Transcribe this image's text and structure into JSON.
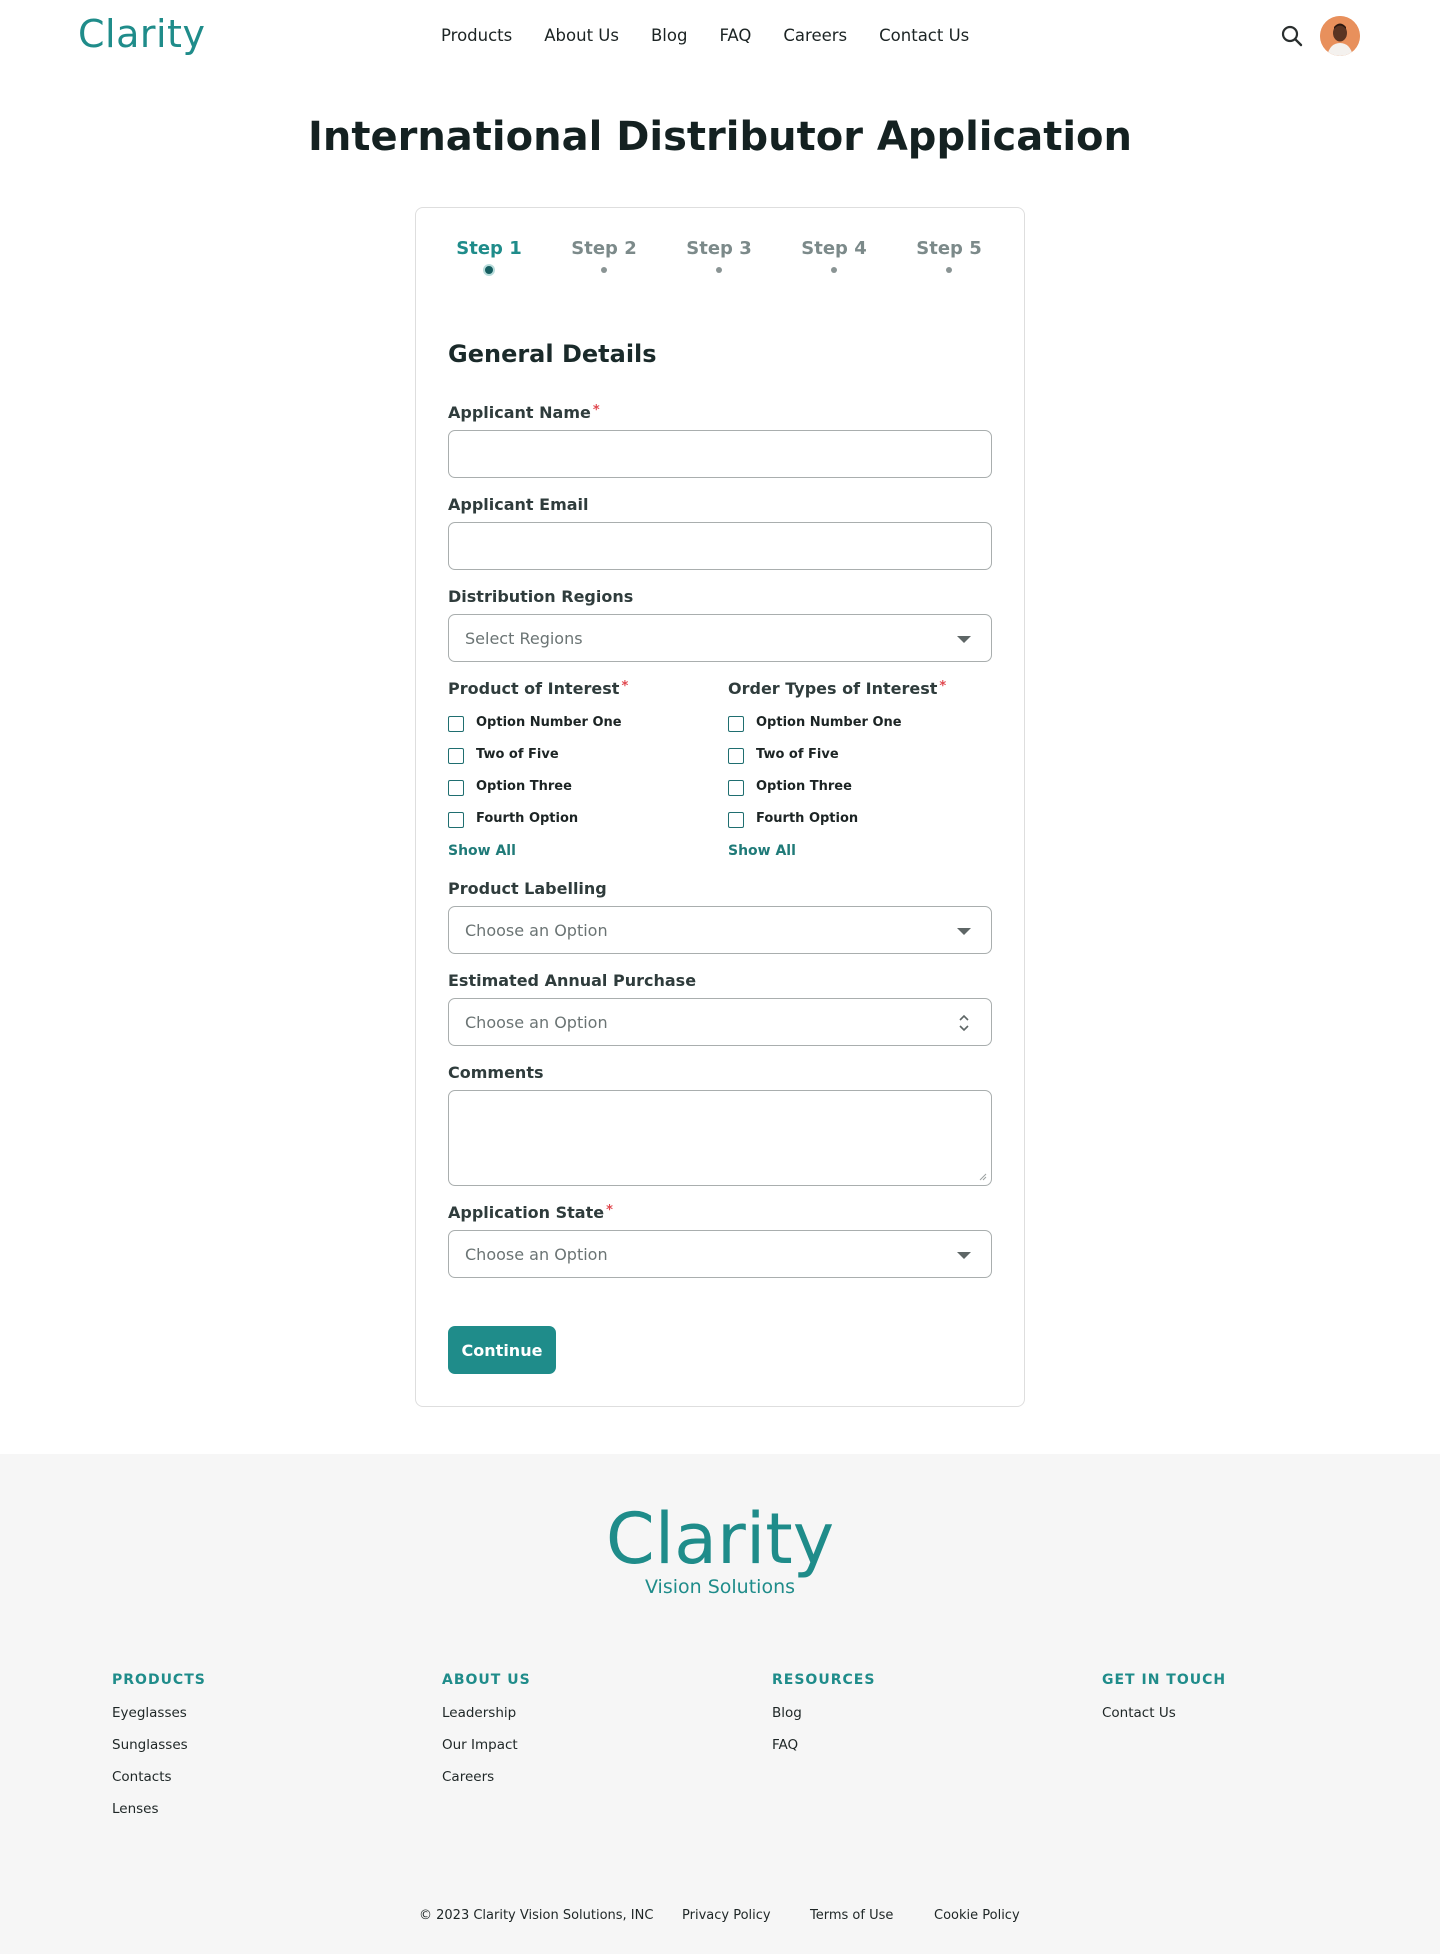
{
  "header": {
    "logo": "Clarity",
    "nav": [
      "Products",
      "About Us",
      "Blog",
      "FAQ",
      "Careers",
      "Contact Us"
    ]
  },
  "page": {
    "title": "International Distributor Application"
  },
  "stepper": {
    "steps": [
      "Step 1",
      "Step 2",
      "Step 3",
      "Step 4",
      "Step 5"
    ],
    "active_step": "Step 1"
  },
  "form": {
    "section_title": "General Details",
    "applicant_name": {
      "label": "Applicant Name",
      "required": "*",
      "value": ""
    },
    "applicant_email": {
      "label": "Applicant Email",
      "value": ""
    },
    "distribution_regions": {
      "label": "Distribution Regions",
      "placeholder": "Select Regions"
    },
    "product_of_interest": {
      "label": "Product of Interest",
      "required": "*",
      "options": [
        "Option Number One",
        "Two of Five",
        "Option Three",
        "Fourth Option"
      ],
      "show_all": "Show All"
    },
    "order_types": {
      "label": "Order Types of Interest",
      "required": "*",
      "options": [
        "Option Number One",
        "Two of Five",
        "Option Three",
        "Fourth Option"
      ],
      "show_all": "Show All"
    },
    "product_labelling": {
      "label": "Product Labelling",
      "placeholder": "Choose an Option"
    },
    "estimated_annual_purchase": {
      "label": "Estimated Annual Purchase",
      "placeholder": "Choose an Option"
    },
    "comments": {
      "label": "Comments",
      "value": ""
    },
    "application_state": {
      "label": "Application State",
      "required": "*",
      "placeholder": "Choose an Option"
    },
    "continue_label": "Continue"
  },
  "footer": {
    "logo": "Clarity",
    "tagline": "Vision Solutions",
    "columns": [
      {
        "title": "PRODUCTS",
        "links": [
          "Eyeglasses",
          "Sunglasses",
          "Contacts",
          "Lenses"
        ]
      },
      {
        "title": "ABOUT US",
        "links": [
          "Leadership",
          "Our Impact",
          "Careers"
        ]
      },
      {
        "title": "RESOURCES",
        "links": [
          "Blog",
          "FAQ"
        ]
      },
      {
        "title": "GET IN TOUCH",
        "links": [
          "Contact Us"
        ]
      }
    ],
    "copyright": "© 2023 Clarity Vision Solutions, INC",
    "legal_links": [
      "Privacy Policy",
      "Terms of Use",
      "Cookie Policy"
    ]
  },
  "colors": {
    "brand": "#1f8c8a",
    "required": "#e0484f",
    "footer_bg": "#f6f6f6"
  },
  "icons": {
    "search": "search-icon",
    "avatar": "user-avatar",
    "caret": "caret-down-icon"
  }
}
